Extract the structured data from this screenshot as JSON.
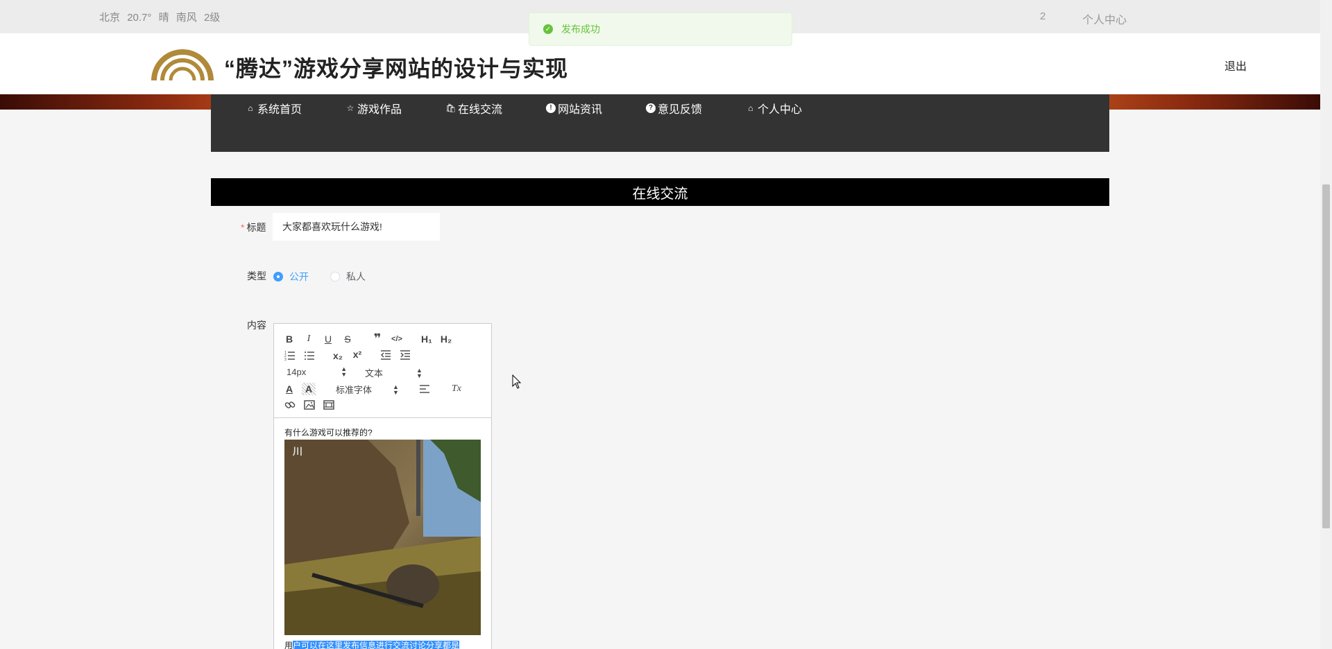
{
  "topbar": {
    "weather": {
      "city": "北京",
      "temperature": "20.7°",
      "condition": "晴",
      "wind": "南风",
      "level": "2级"
    },
    "count": "2",
    "user_center": "个人中心"
  },
  "toast": {
    "message": "发布成功",
    "status": "success",
    "color": "#67c23a"
  },
  "header": {
    "site_title": "“腾达”游戏分享网站的设计与实现",
    "logout_label": "退出",
    "logo_color": "#b08a3a"
  },
  "nav": {
    "items": [
      {
        "label": "系统首页",
        "icon": "home-icon"
      },
      {
        "label": "游戏作品",
        "icon": "star-icon"
      },
      {
        "label": "在线交流",
        "icon": "bag-icon"
      },
      {
        "label": "网站资讯",
        "icon": "info-icon"
      },
      {
        "label": "意见反馈",
        "icon": "question-icon"
      },
      {
        "label": "个人中心",
        "icon": "home-icon"
      }
    ]
  },
  "page": {
    "section_title": "在线交流"
  },
  "form": {
    "title_label": "标题",
    "title_value": "大家都喜欢玩什么游戏!",
    "type_label": "类型",
    "type_options": [
      "公开",
      "私人"
    ],
    "type_selected": "公开",
    "content_label": "内容",
    "accent_color": "#409eff"
  },
  "editor": {
    "toolbar": {
      "bold": "B",
      "italic": "I",
      "underline": "U",
      "strike": "S",
      "h1": "H₁",
      "h2": "H₂",
      "subscript": "x₂",
      "superscript": "x²",
      "font_size": "14px",
      "header": "文本",
      "font_family": "标准字体",
      "clean": "Tx"
    },
    "content_text": "有什么游戏可以推荐的?",
    "selected_text_prefix": "用",
    "selected_text": "户可以在这里发布信息进行交流讨论分享都是"
  }
}
